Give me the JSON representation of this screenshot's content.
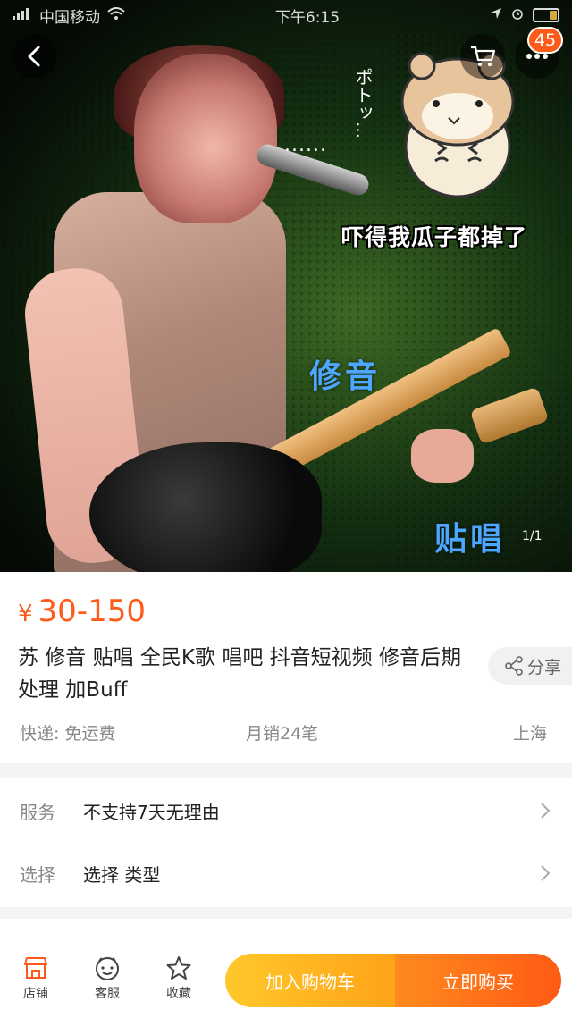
{
  "status_bar": {
    "carrier": "中国移动",
    "time": "下午6:15"
  },
  "header": {
    "cart_badge_count": "45"
  },
  "gallery": {
    "overlay_dots": "......",
    "overlay_vertical": "ポトッ...",
    "overlay_caption": "吓得我瓜子都掉了",
    "overlay_tag_1": "修音",
    "overlay_tag_2": "贴唱",
    "image_index": "1/1"
  },
  "product": {
    "currency": "¥",
    "price": "30-150",
    "title": "苏 修音 贴唱 全民K歌 唱吧 抖音短视频 修音后期处理  加Buff",
    "share_label": "分享",
    "shipping": "快递: 免运费",
    "monthly_sales": "月销24笔",
    "location": "上海"
  },
  "options": {
    "service_label": "服务",
    "service_value": "不支持7天无理由",
    "select_label": "选择",
    "select_value": "选择  类型"
  },
  "bottom_bar": {
    "shop_label": "店铺",
    "service_label": "客服",
    "favorite_label": "收藏",
    "add_to_cart_label": "加入购物车",
    "buy_now_label": "立即购买"
  },
  "colors": {
    "accent": "#ff5a1a",
    "cart_button": "#ffb41f",
    "buy_button": "#ff6a16"
  }
}
